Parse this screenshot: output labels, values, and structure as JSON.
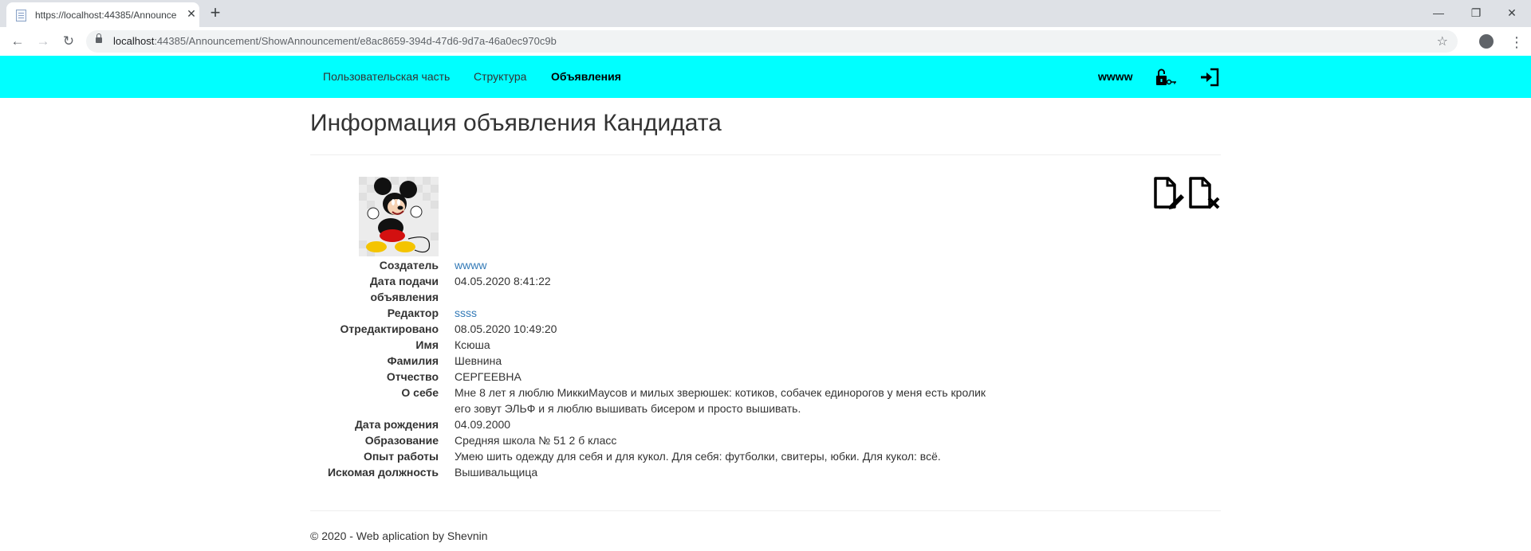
{
  "browser": {
    "tab_title": "https://localhost:44385/Announce",
    "tab_close": "✕",
    "new_tab": "+",
    "url_host": "localhost",
    "url_rest": ":44385/Announcement/ShowAnnouncement/e8ac8659-394d-47d6-9d7a-46a0ec970c9b",
    "minimize": "—",
    "restore": "❐",
    "close": "✕"
  },
  "sitenav": {
    "links": [
      "Пользовательская часть",
      "Структура",
      "Объявления"
    ],
    "active_index": 2,
    "username": "wwww",
    "bg_color": "#00ffff"
  },
  "page": {
    "title": "Информация объявления Кандидата"
  },
  "details": [
    {
      "label": "Создатель",
      "value": "wwww",
      "link": true
    },
    {
      "label": "Дата подачи объявления",
      "value": "04.05.2020 8:41:22"
    },
    {
      "label": "Редактор",
      "value": "ssss",
      "link": true
    },
    {
      "label": "Отредактировано",
      "value": "08.05.2020 10:49:20"
    },
    {
      "label": "Имя",
      "value": "Ксюша"
    },
    {
      "label": "Фамилия",
      "value": "Шевнина"
    },
    {
      "label": "Отчество",
      "value": "СЕРГЕЕВНА"
    },
    {
      "label": "О себе",
      "value": "Мне 8 лет я люблю МиккиМаусов и милых зверюшек: котиков, собачек единорогов у меня есть кролик его зовут ЭЛЬФ и я люблю вышивать бисером и просто вышивать."
    },
    {
      "label": "Дата рождения",
      "value": "04.09.2000"
    },
    {
      "label": "Образование",
      "value": "Средняя школа № 51 2 б класс"
    },
    {
      "label": "Опыт работы",
      "value": "Умею шить одежду для себя и для кукол. Для себя: футболки, свитеры, юбки. Для кукол: всё."
    },
    {
      "label": "Искомая должность",
      "value": "Вышивальщица"
    }
  ],
  "footer": {
    "text": "© 2020 - Web aplication by Shevnin"
  }
}
